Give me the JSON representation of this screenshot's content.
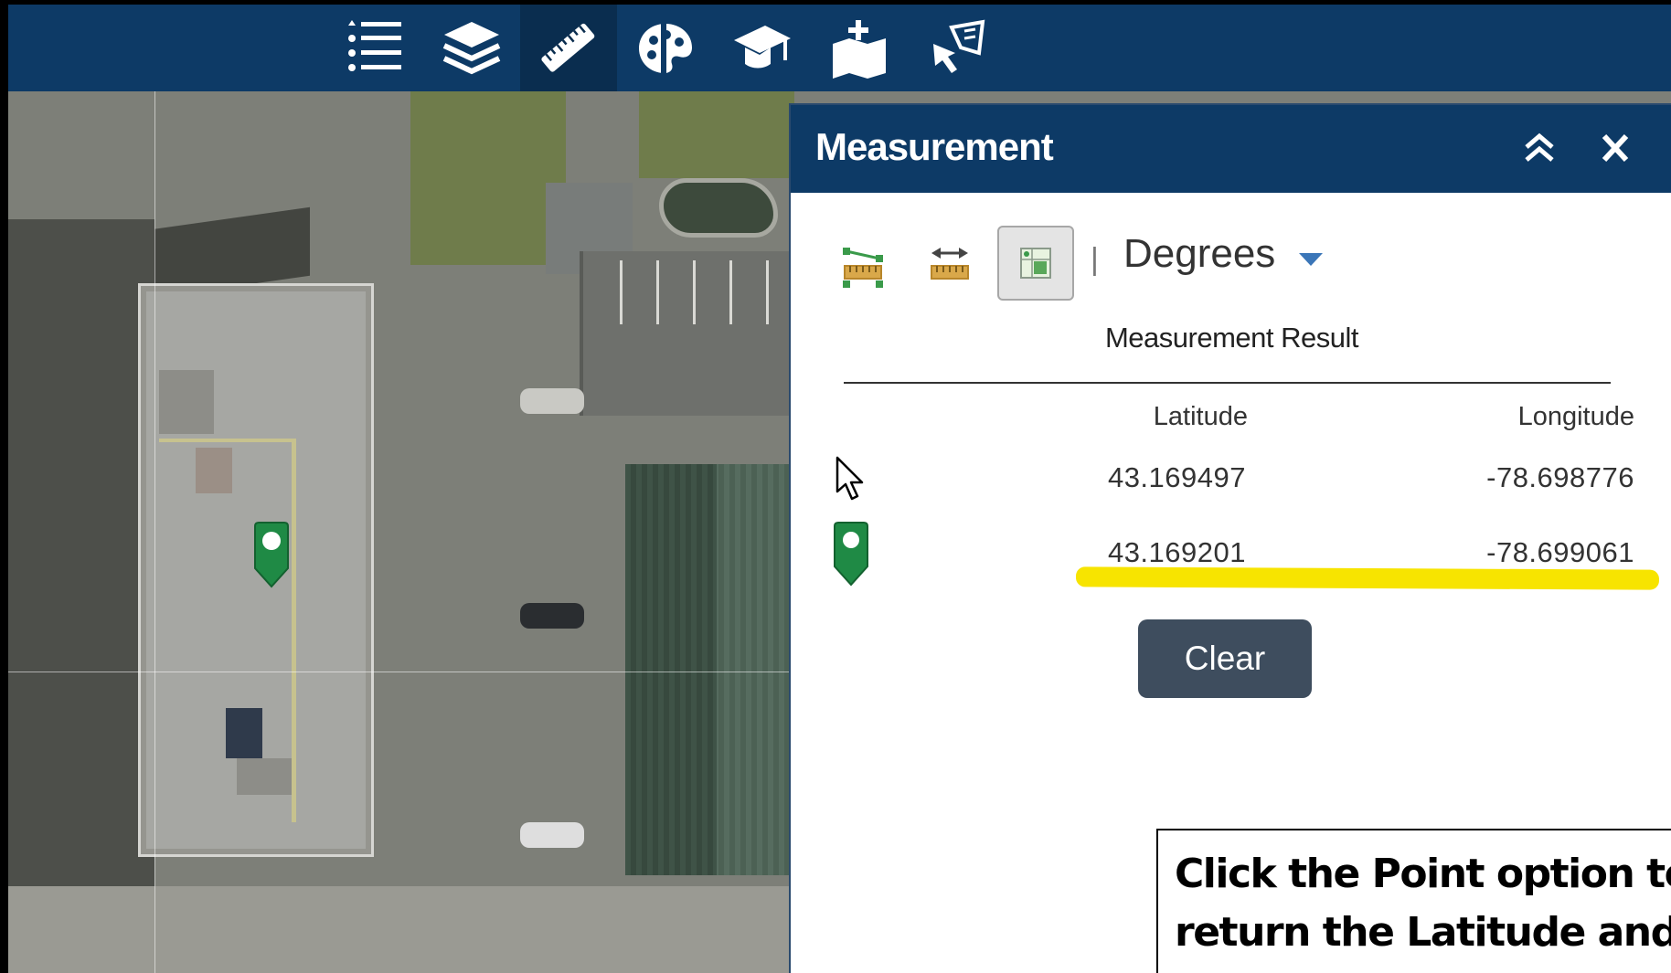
{
  "toolbar": {
    "buttons": [
      {
        "icon": "legend-list-icon",
        "active": false
      },
      {
        "icon": "layers-icon",
        "active": false
      },
      {
        "icon": "ruler-measure-icon",
        "active": true
      },
      {
        "icon": "basemap-palette-icon",
        "active": false
      },
      {
        "icon": "learn-graduation-cap-icon",
        "active": false
      },
      {
        "icon": "add-data-map-icon",
        "active": false
      },
      {
        "icon": "select-features-icon",
        "active": false
      }
    ],
    "colors": {
      "background": "#0d3a66",
      "active": "#0a2d4f"
    }
  },
  "panel": {
    "title": "Measurement",
    "unit": "Degrees",
    "result_title": "Measurement Result",
    "columns": {
      "latitude": "Latitude",
      "longitude": "Longitude"
    },
    "rows": [
      {
        "icon": "cursor-icon",
        "latitude": "43.169497",
        "longitude": "-78.698776"
      },
      {
        "icon": "map-pin-icon",
        "latitude": "43.169201",
        "longitude": "-78.699061"
      }
    ],
    "clear_label": "Clear",
    "tools": [
      "area-tool-icon",
      "distance-tool-icon",
      "location-tool-icon"
    ],
    "highlight_color": "#f7e400"
  },
  "callout": {
    "text": "Click the Point option to return the Latitude and Longitude of a point."
  }
}
